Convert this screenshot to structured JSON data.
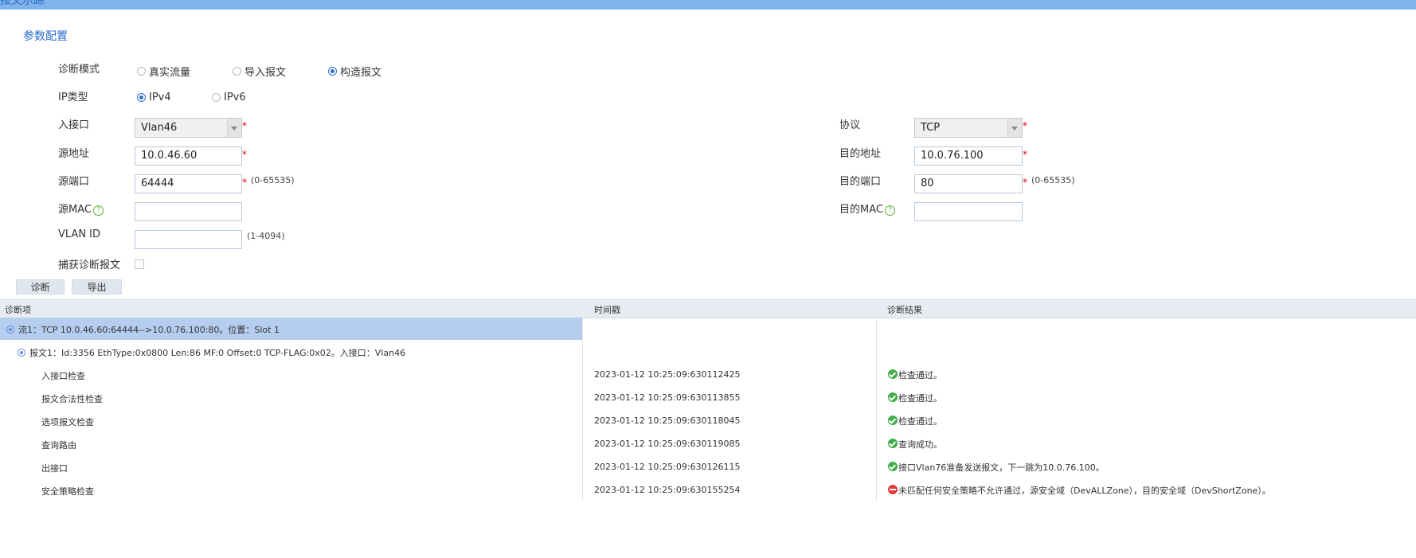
{
  "window": {
    "title": "报文示踪"
  },
  "section_title": "参数配置",
  "form": {
    "mode": {
      "label": "诊断模式",
      "options": [
        "真实流量",
        "导入报文",
        "构造报文"
      ],
      "selected": 2
    },
    "ip_type": {
      "label": "IP类型",
      "options": [
        "IPv4",
        "IPv6"
      ],
      "selected": 0
    },
    "in_interface": {
      "label": "入接口",
      "value": "Vlan46"
    },
    "protocol": {
      "label": "协议",
      "value": "TCP"
    },
    "src_addr": {
      "label": "源地址",
      "value": "10.0.46.60"
    },
    "dst_addr": {
      "label": "目的地址",
      "value": "10.0.76.100"
    },
    "src_port": {
      "label": "源端口",
      "value": "64444",
      "hint": "(0-65535)"
    },
    "dst_port": {
      "label": "目的端口",
      "value": "80",
      "hint": "(0-65535)"
    },
    "src_mac": {
      "label": "源MAC",
      "value": ""
    },
    "dst_mac": {
      "label": "目的MAC",
      "value": ""
    },
    "vlan_id": {
      "label": "VLAN ID",
      "value": "",
      "hint": "(1-4094)"
    },
    "capture": {
      "label": "捕获诊断报文",
      "checked": false
    },
    "required_mark": "*",
    "help_mark": "?"
  },
  "buttons": {
    "diagnose": "诊断",
    "export": "导出"
  },
  "table": {
    "headers": [
      "诊断项",
      "时间戳",
      "诊断结果"
    ],
    "flow": "流1：TCP 10.0.46.60:64444-->10.0.76.100:80。位置：Slot 1",
    "packet": "报文1：Id:3356 EthType:0x0800 Len:86 MF:0 Offset:0 TCP-FLAG:0x02。入接口：Vlan46",
    "rows": [
      {
        "item": "入接口检查",
        "time": "2023-01-12 10:25:09:630112425",
        "result": "检查通过。",
        "status": "ok"
      },
      {
        "item": "报文合法性检查",
        "time": "2023-01-12 10:25:09:630113855",
        "result": "检查通过。",
        "status": "ok"
      },
      {
        "item": "选项报文检查",
        "time": "2023-01-12 10:25:09:630118045",
        "result": "检查通过。",
        "status": "ok"
      },
      {
        "item": "查询路由",
        "time": "2023-01-12 10:25:09:630119085",
        "result": "查询成功。",
        "status": "ok"
      },
      {
        "item": "出接口",
        "time": "2023-01-12 10:25:09:630126115",
        "result": "接口Vlan76准备发送报文，下一跳为10.0.76.100。",
        "status": "ok"
      },
      {
        "item": "安全策略检查",
        "time": "2023-01-12 10:25:09:630155254",
        "result": "未匹配任何安全策略不允许通过，源安全域（DevALLZone），目的安全域（DevShortZone）。",
        "status": "error"
      }
    ]
  },
  "colors": {
    "accent": "#2b6ccc",
    "title_bar": "#7eb4ea",
    "selected_row": "#b5cdef",
    "ok": "#3fae49",
    "error": "#e23c3c"
  }
}
